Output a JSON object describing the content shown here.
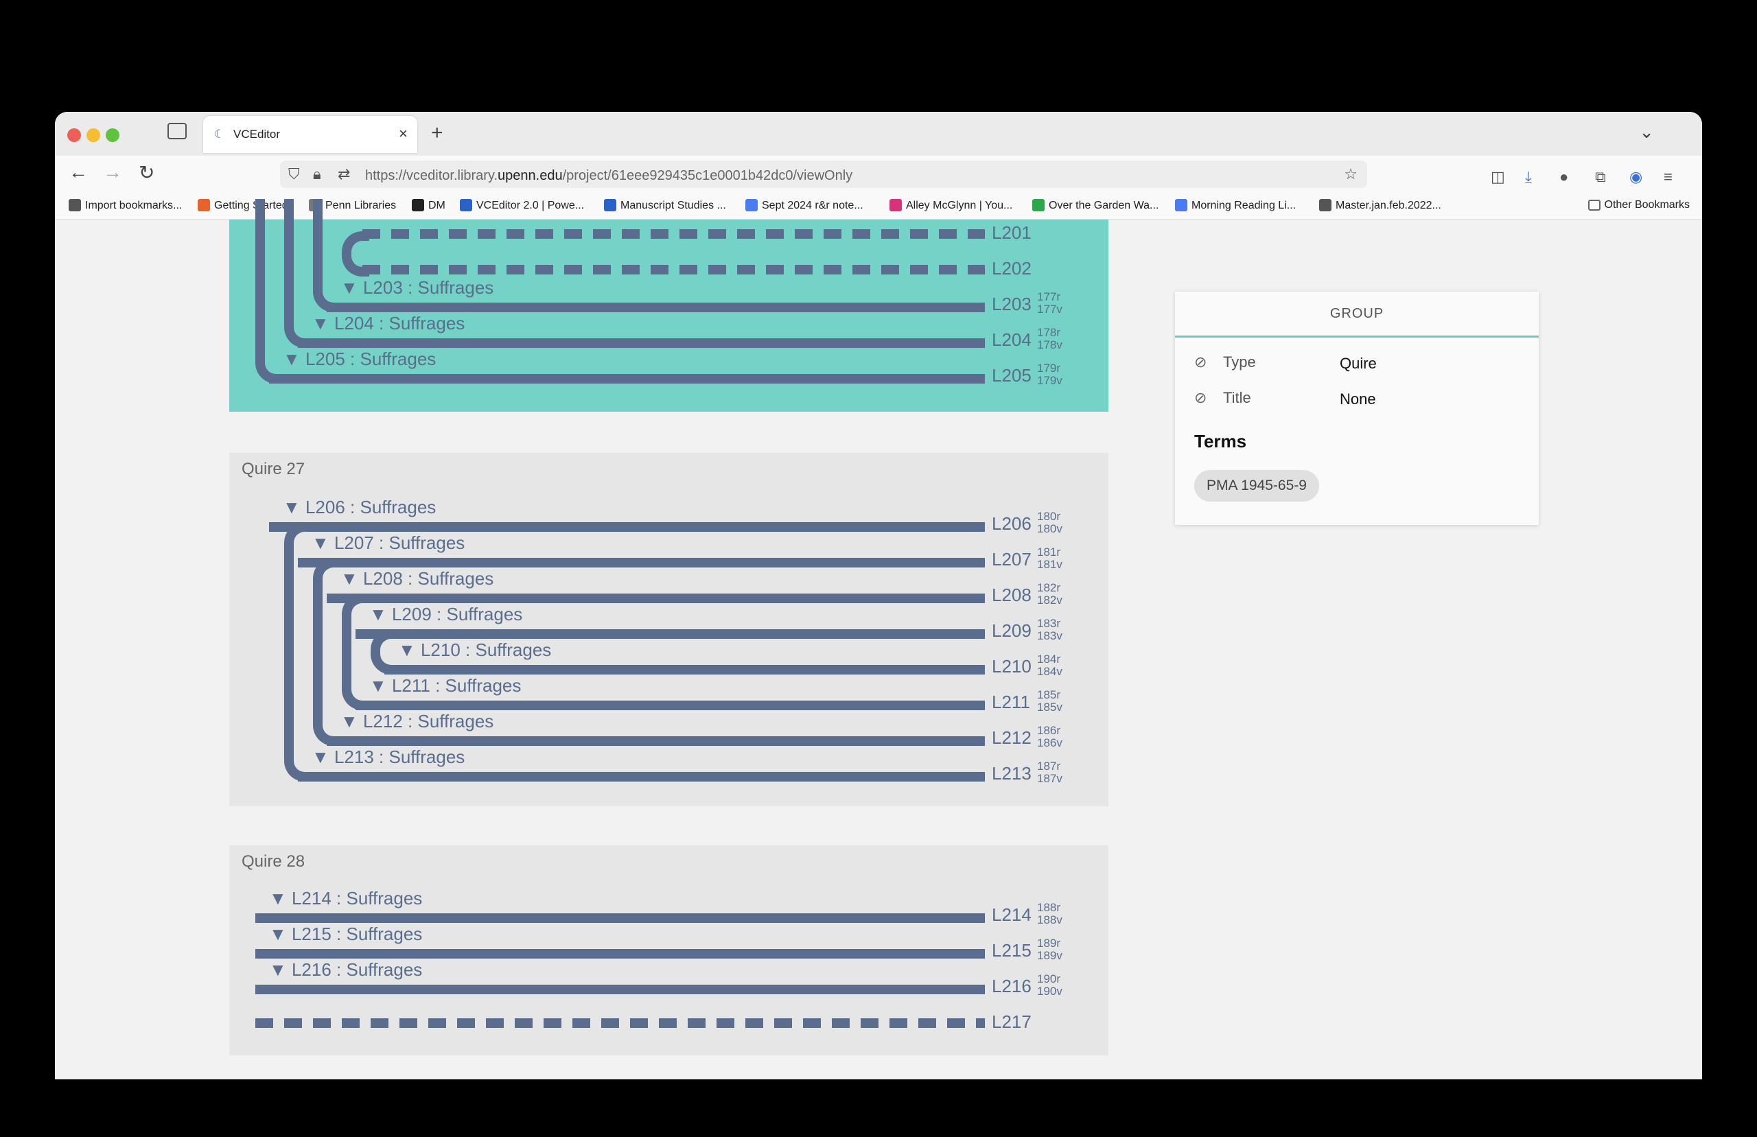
{
  "browser": {
    "tab_title": "VCEditor",
    "url_prefix": "https://vceditor.library.",
    "url_domain": "upenn.edu",
    "url_path": "/project/61eee929435c1e0001b42dc0/viewOnly",
    "bookmarks": [
      {
        "label": "Import bookmarks...",
        "color": "#555555"
      },
      {
        "label": "Getting Started",
        "color": "#e8632c"
      },
      {
        "label": "Penn Libraries",
        "color": "#777777"
      },
      {
        "label": "DM",
        "color": "#222222"
      },
      {
        "label": "VCEditor 2.0 | Powe...",
        "color": "#2a63c8"
      },
      {
        "label": "Manuscript Studies ...",
        "color": "#2a63c8"
      },
      {
        "label": "Sept 2024 r&r note...",
        "color": "#4a7bf0"
      },
      {
        "label": "Alley McGlynn | You...",
        "color": "#d9317a"
      },
      {
        "label": "Over the Garden Wa...",
        "color": "#2ba84a"
      },
      {
        "label": "Morning Reading Li...",
        "color": "#4a7bf0"
      },
      {
        "label": "Master.jan.feb.2022...",
        "color": "#555555"
      }
    ],
    "other_bookmarks": "Other Bookmarks"
  },
  "quires": [
    {
      "title": "",
      "background": "#75d2c6",
      "leaves": [
        {
          "id": "L201",
          "title": "",
          "folio_r": "",
          "folio_v": "",
          "dashed": true
        },
        {
          "id": "L202",
          "title": "",
          "folio_r": "",
          "folio_v": "",
          "dashed": true
        },
        {
          "id": "L203",
          "title": "L203 : Suffrages",
          "folio_r": "177r",
          "folio_v": "177v",
          "dashed": false
        },
        {
          "id": "L204",
          "title": "L204 : Suffrages",
          "folio_r": "178r",
          "folio_v": "178v",
          "dashed": false
        },
        {
          "id": "L205",
          "title": "L205 : Suffrages",
          "folio_r": "179r",
          "folio_v": "179v",
          "dashed": false
        }
      ]
    },
    {
      "title": "Quire 27",
      "background": "#e6e6e6",
      "leaves": [
        {
          "id": "L206",
          "title": "L206 : Suffrages",
          "folio_r": "180r",
          "folio_v": "180v",
          "dashed": false
        },
        {
          "id": "L207",
          "title": "L207 : Suffrages",
          "folio_r": "181r",
          "folio_v": "181v",
          "dashed": false
        },
        {
          "id": "L208",
          "title": "L208 : Suffrages",
          "folio_r": "182r",
          "folio_v": "182v",
          "dashed": false
        },
        {
          "id": "L209",
          "title": "L209 : Suffrages",
          "folio_r": "183r",
          "folio_v": "183v",
          "dashed": false
        },
        {
          "id": "L210",
          "title": "L210 : Suffrages",
          "folio_r": "184r",
          "folio_v": "184v",
          "dashed": false
        },
        {
          "id": "L211",
          "title": "L211 : Suffrages",
          "folio_r": "185r",
          "folio_v": "185v",
          "dashed": false
        },
        {
          "id": "L212",
          "title": "L212 : Suffrages",
          "folio_r": "186r",
          "folio_v": "186v",
          "dashed": false
        },
        {
          "id": "L213",
          "title": "L213 : Suffrages",
          "folio_r": "187r",
          "folio_v": "187v",
          "dashed": false
        }
      ]
    },
    {
      "title": "Quire 28",
      "background": "#e6e6e6",
      "leaves": [
        {
          "id": "L214",
          "title": "L214 : Suffrages",
          "folio_r": "188r",
          "folio_v": "188v",
          "dashed": false
        },
        {
          "id": "L215",
          "title": "L215 : Suffrages",
          "folio_r": "189r",
          "folio_v": "189v",
          "dashed": false
        },
        {
          "id": "L216",
          "title": "L216 : Suffrages",
          "folio_r": "190r",
          "folio_v": "190v",
          "dashed": false
        },
        {
          "id": "L217",
          "title": "",
          "folio_r": "",
          "folio_v": "",
          "dashed": true
        }
      ]
    }
  ],
  "panel": {
    "header": "GROUP",
    "type_label": "Type",
    "type_value": "Quire",
    "title_label": "Title",
    "title_value": "None",
    "terms_heading": "Terms",
    "term_chip": "PMA 1945-65-9"
  },
  "colors": {
    "leaf": "#5a6d8f",
    "accent": "#6fc7be",
    "selected_quire": "#75d2c6"
  }
}
